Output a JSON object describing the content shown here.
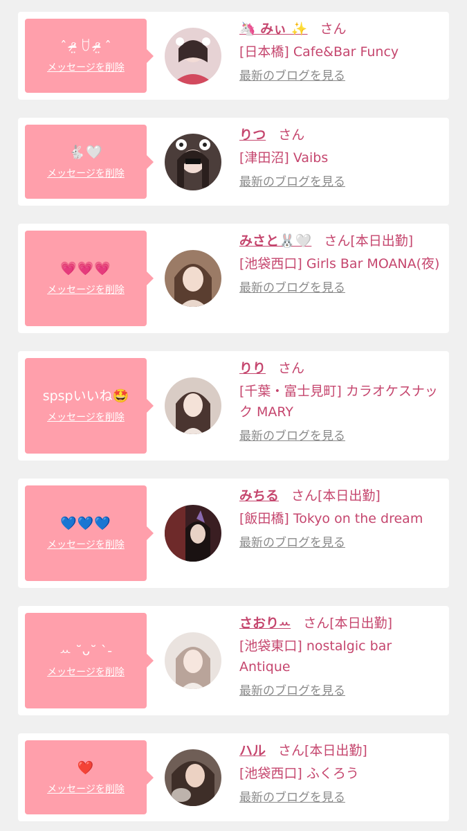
{
  "delete_label": "メッセージを削除",
  "blog_label": "最新のブログを見る",
  "cards": [
    {
      "message": "ˆ ᵒ̴̶̷̤ ꇴ ᵒ̴̶̷̤ ˆ",
      "name": "🦄 みぃ ✨",
      "suffix": "さん",
      "shop": "[日本橋] Cafe&Bar Funcy"
    },
    {
      "message": "🐇🤍",
      "name": "りつ",
      "suffix": "さん",
      "shop": "[津田沼] Vaibs"
    },
    {
      "message": "💗💗💗",
      "name": "みさと🐰🤍",
      "suffix": "さん[本日出勤]",
      "shop": "[池袋西口] Girls Bar MOANA(夜)"
    },
    {
      "message": "spspいいね🤩",
      "name": "りり",
      "suffix": "さん",
      "shop": "[千葉・富士見町] カラオケスナック MARY"
    },
    {
      "message": "💙💙💙",
      "name": "みちる",
      "suffix": "さん[本日出勤]",
      "shop": "[飯田橋] Tokyo on the dream"
    },
    {
      "message": "ꕀ ˘ᴗ˘ ˋ-",
      "name": "さおりꕀ",
      "suffix": "さん[本日出勤]",
      "shop": "[池袋東口] nostalgic bar Antique"
    },
    {
      "message": "❤️",
      "name": "ハル",
      "suffix": "さん[本日出勤]",
      "shop": "[池袋西口] ふくろう"
    }
  ],
  "avatars": [
    {
      "icon": "avatar-photo-1",
      "color": "#c9a6a8"
    },
    {
      "icon": "avatar-photo-2",
      "color": "#6b5a55"
    },
    {
      "icon": "avatar-photo-3",
      "color": "#8a6a5a"
    },
    {
      "icon": "avatar-photo-4",
      "color": "#b8a8a0"
    },
    {
      "icon": "avatar-photo-5",
      "color": "#5a3a3a"
    },
    {
      "icon": "avatar-photo-6",
      "color": "#d8ccc6"
    },
    {
      "icon": "avatar-photo-7",
      "color": "#7a6860"
    }
  ],
  "colors": {
    "bubble": "#ff9fab",
    "accent": "#c5466e",
    "link_gray": "#8a8a8a",
    "background": "#f0f0f0"
  }
}
